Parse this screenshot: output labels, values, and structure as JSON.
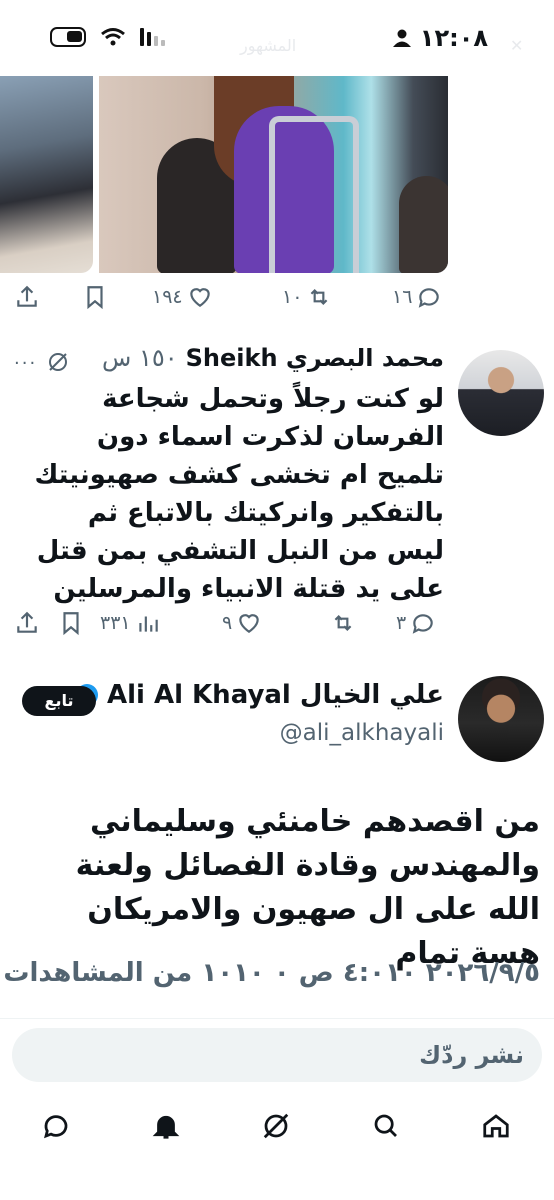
{
  "status_bar": {
    "time": "١٢:٠٨",
    "ghost_left": "المشهور",
    "ghost_right": "✕"
  },
  "tweet_above": {
    "actions": {
      "share": "",
      "bookmark": "",
      "likes": "١٩٤",
      "retweets": "١٠",
      "replies": "١٦"
    }
  },
  "reply_tweet": {
    "name": "محمد البصري Sheikh",
    "time_ago": "١٥٠ س",
    "text": "لو كنت رجلاً وتحمل شجاعة الفرسان لذكرت اسماء دون تلميح ام تخشى كشف صهيونيتك بالتفكير وانركيتك بالاتباع ثم ليس من النبل التشفي بمن قتل على يد قتلة الانبياء والمرسلين",
    "actions": {
      "views": "٣٣١",
      "likes": "٩",
      "retweets": "",
      "replies": "٣"
    }
  },
  "main_tweet": {
    "name": "علي الخيال Ali Al Khayal",
    "handle": "@ali_alkhayali",
    "follow_label": "تابع",
    "text": "من اقصدهم خامنئي وسليماني والمهندس  وقادة الفصائل ولعنة الله على ال صهيون والامريكان هسة تمام",
    "meta": "٢٠٢٦/٩/٥ ٤:٠١٠ ص ٠ ١٠١٠ من المشاهدات"
  },
  "reply_input": {
    "placeholder": "نشر ردّك"
  },
  "colors": {
    "text": "#0f1419",
    "muted": "#536471",
    "verified": "#1d9bf0"
  }
}
